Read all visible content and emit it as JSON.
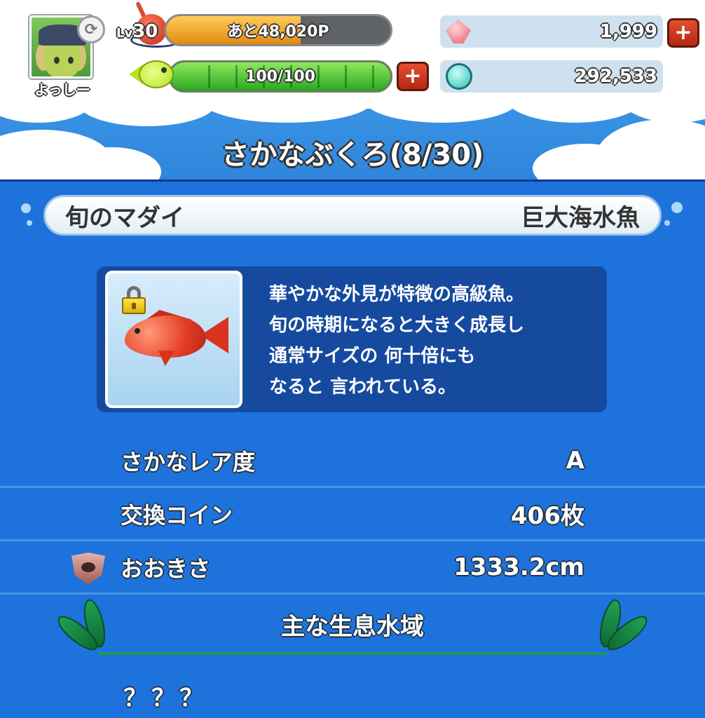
{
  "header": {
    "player_name": "よっしー",
    "level_prefix": "Lv",
    "level": "30",
    "exp_label": "あと48,020P",
    "exp_progress": 0.6,
    "stamina_label": "100/100",
    "stamina_progress": 1.0,
    "plus_symbol": "+",
    "gems": "1,999",
    "coins": "292,533"
  },
  "title": "さかなぶくろ(8/30)",
  "fish": {
    "name": "旬のマダイ",
    "category": "巨大海水魚",
    "description_lines": [
      "華やかな外見が特徴の高級魚。",
      "旬の時期になると大きく成長し",
      "通常サイズの 何十倍にも",
      "なると 言われている。"
    ]
  },
  "stats": {
    "rarity_label": "さかなレア度",
    "rarity_value": "A",
    "coins_label": "交換コイン",
    "coins_value": "406枚",
    "size_label": "おおきさ",
    "size_value": "1333.2cm"
  },
  "habitat": {
    "title": "主な生息水域",
    "value": "？？？"
  },
  "colors": {
    "main_bg": "#1e72dc",
    "exp_fill": "#e28a12",
    "stamina_fill": "#2aa822",
    "plus_button": "#c53a1d"
  },
  "icons": [
    "avatar",
    "swap-icon",
    "bobber-icon",
    "fish-stamina-icon",
    "gem-icon",
    "coin-icon",
    "lock-icon",
    "fish-image",
    "shield-fish-icon",
    "seaweed-icon"
  ]
}
